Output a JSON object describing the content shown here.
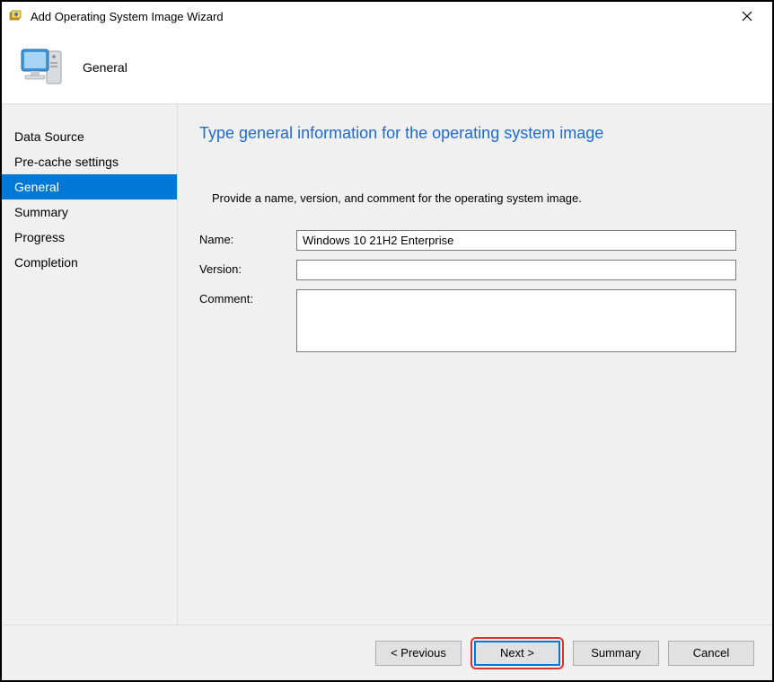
{
  "window": {
    "title": "Add Operating System Image Wizard"
  },
  "header": {
    "label": "General"
  },
  "sidebar": {
    "items": [
      {
        "label": "Data Source"
      },
      {
        "label": "Pre-cache settings"
      },
      {
        "label": "General"
      },
      {
        "label": "Summary"
      },
      {
        "label": "Progress"
      },
      {
        "label": "Completion"
      }
    ]
  },
  "content": {
    "heading": "Type general information for the operating system image",
    "instruction": "Provide a name, version, and comment for the operating system image.",
    "name_label": "Name:",
    "name_value": "Windows 10 21H2 Enterprise",
    "version_label": "Version:",
    "version_value": "",
    "comment_label": "Comment:",
    "comment_value": ""
  },
  "footer": {
    "previous": "< Previous",
    "next": "Next >",
    "summary": "Summary",
    "cancel": "Cancel"
  }
}
